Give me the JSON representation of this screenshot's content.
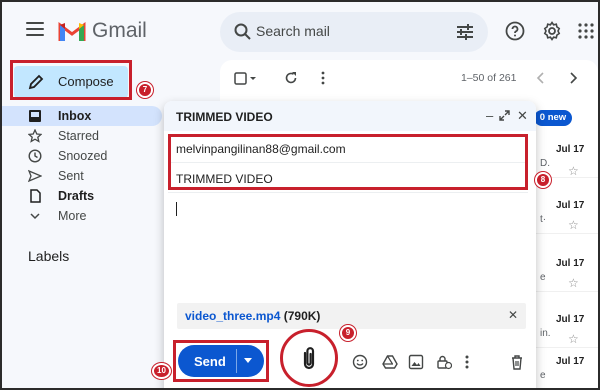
{
  "header": {
    "logo_text": "Gmail",
    "search_placeholder": "Search mail"
  },
  "sidebar": {
    "compose_label": "Compose",
    "items": [
      {
        "label": "Inbox",
        "icon": "inbox-icon"
      },
      {
        "label": "Starred",
        "icon": "star-icon"
      },
      {
        "label": "Snoozed",
        "icon": "clock-icon"
      },
      {
        "label": "Sent",
        "icon": "send-icon"
      },
      {
        "label": "Drafts",
        "icon": "draft-icon"
      },
      {
        "label": "More",
        "icon": "chevron-down-icon"
      }
    ],
    "labels_heading": "Labels"
  },
  "list": {
    "count_text": "1–50 of 261",
    "new_badge": "0 new",
    "rows": [
      {
        "date": "Jul 17",
        "snippet": "D."
      },
      {
        "date": "Jul 17",
        "snippet": "t·"
      },
      {
        "date": "Jul 17",
        "snippet": "e"
      },
      {
        "date": "Jul 17",
        "snippet": "in."
      },
      {
        "date": "Jul 17",
        "snippet": "e"
      }
    ]
  },
  "compose": {
    "title": "TRIMMED VIDEO",
    "to": "melvinpangilinan88@gmail.com",
    "subject": "TRIMMED VIDEO",
    "attachment_name": "video_three.mp4",
    "attachment_size": "(790K)",
    "send_label": "Send"
  },
  "annotations": {
    "step7": "7",
    "step8": "8",
    "step9": "9",
    "step10": "10"
  },
  "colors": {
    "highlight": "#c8202c",
    "compose_bg": "#c2e7ff",
    "send_bg": "#0b57d0"
  }
}
